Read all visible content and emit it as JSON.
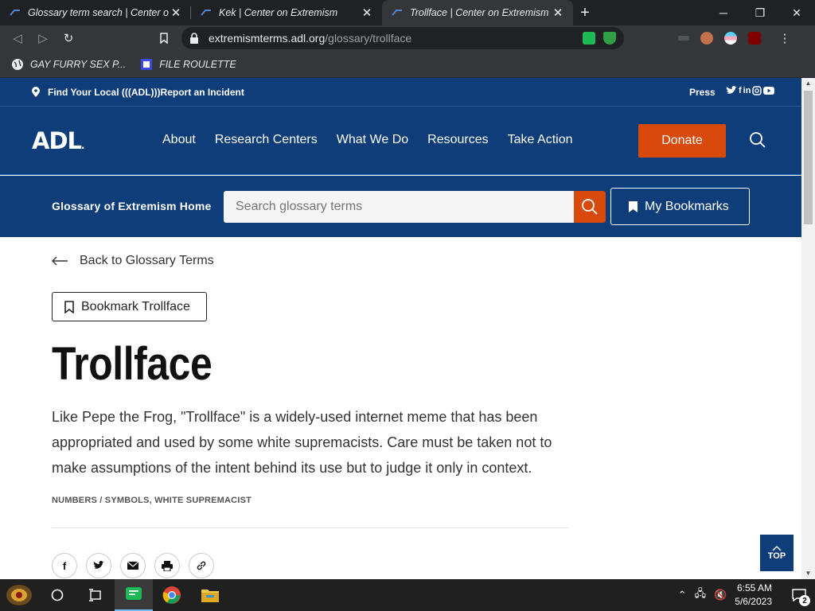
{
  "browser": {
    "tabs": [
      {
        "title": "Glossary term search | Center on Extremism",
        "active": false
      },
      {
        "title": "Kek | Center on Extremism",
        "active": false
      },
      {
        "title": "Trollface | Center on Extremism",
        "active": true
      }
    ],
    "url_host": "extremismterms.adl.org",
    "url_path": "/glossary/trollface",
    "bookmarks": [
      {
        "label": "GAY FURRY SEX P..."
      },
      {
        "label": "FILE ROULETTE"
      }
    ]
  },
  "site": {
    "topbar": {
      "find_local": "Find Your Local (((ADL)))",
      "report": "Report an Incident",
      "press": "Press",
      "social": [
        "twitter-icon",
        "facebook-icon",
        "linkedin-icon",
        "instagram-icon",
        "youtube-icon"
      ]
    },
    "logo": "ADL",
    "nav": [
      "About",
      "Research Centers",
      "What We Do",
      "Resources",
      "Take Action"
    ],
    "donate": "Donate",
    "glossary_home": "Glossary of Extremism Home",
    "search_placeholder": "Search glossary terms",
    "my_bookmarks": "My Bookmarks",
    "back_link": "Back to Glossary Terms",
    "bookmark_button": "Bookmark Trollface",
    "term_title": "Trollface",
    "description": "Like Pepe the Frog, \"Trollface\" is a widely-used internet meme that has been appropriated and used by some white supremacists. Care must be taken not to make assumptions of the intent behind its use but to judge it only in context.",
    "tags": "NUMBERS / SYMBOLS, WHITE SUPREMACIST",
    "share_icons": [
      "facebook-icon",
      "twitter-icon",
      "mail-icon",
      "print-icon",
      "link-icon"
    ],
    "top_button": "TOP"
  },
  "taskbar": {
    "time": "6:55 AM",
    "date": "5/6/2023",
    "notifications": "2"
  },
  "colors": {
    "brand_navy": "#0f3d7a",
    "accent_orange": "#d84a0b"
  }
}
